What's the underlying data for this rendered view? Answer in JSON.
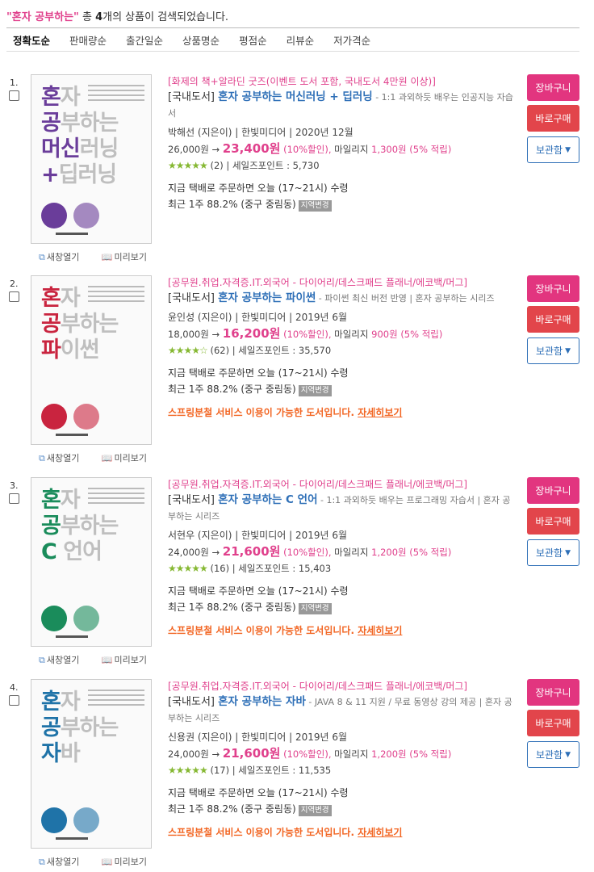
{
  "header": {
    "query": "\"혼자 공부하는\"",
    "prefix": " 총 ",
    "count": "4",
    "suffix": "개의 상품이 검색되었습니다."
  },
  "sort_options": [
    "정확도순",
    "판매량순",
    "출간일순",
    "상품명순",
    "평점순",
    "리뷰순",
    "저가격순"
  ],
  "actions": {
    "cart": "장바구니",
    "buy": "바로구매",
    "keep": "보관함"
  },
  "cover_links": {
    "new_window": "새창열기",
    "preview": "미리보기"
  },
  "colors": {
    "pink": "#e0408c",
    "title_blue": "#2e6fb7",
    "orange": "#f26522",
    "star_green": "#86b833"
  },
  "items": [
    {
      "num": "1.",
      "cover": {
        "l1": [
          "혼",
          "자"
        ],
        "l2": [
          "공",
          "부하는"
        ],
        "l3": [
          "머신",
          "러닝"
        ],
        "l4": [
          "+",
          "딥러닝"
        ],
        "color": "#6a3d9a"
      },
      "event": "[화제의 책+알라딘 굿즈(이벤트 도서 포함, 국내도서 4만원 이상)]",
      "category": "[국내도서]",
      "title": "혼자 공부하는 머신러닝 + 딥러닝",
      "subtitle": " - 1:1 과외하듯 배우는 인공지능 자습서",
      "meta": "박해선 (지은이) | 한빛미디어 | 2020년 12월",
      "list_price": "26,000원 →",
      "sale_price": "23,400원",
      "discount": "(10%할인),",
      "mileage_label": " 마일리지",
      "mileage": "1,300원",
      "rate": "(5% 적립)",
      "stars": "★★★★★",
      "reviews": "(2)",
      "salespoint": "세일즈포인트 : 5,730",
      "delivery1": "지금 택배로 주문하면 오늘 (17~21시) 수령",
      "delivery2": "최근 1주 88.2% (중구 중림동)",
      "region": "지역변경",
      "spring": "",
      "spring_more": ""
    },
    {
      "num": "2.",
      "cover": {
        "l1": [
          "혼",
          "자"
        ],
        "l2": [
          "공",
          "부하는"
        ],
        "l3": [
          "파",
          "이썬"
        ],
        "l4": [
          "",
          ""
        ],
        "color": "#c9243f"
      },
      "event": "[공무원.취업.자격증.IT.외국어 - 다이어리/데스크패드 플래너/에코백/머그]",
      "category": "[국내도서]",
      "title": "혼자 공부하는 파이썬",
      "subtitle": " - 파이썬 최신 버전 반영 | 혼자 공부하는 시리즈",
      "meta": "윤인성 (지은이) | 한빛미디어 | 2019년 6월",
      "list_price": "18,000원 →",
      "sale_price": "16,200원",
      "discount": "(10%할인),",
      "mileage_label": " 마일리지",
      "mileage": "900원",
      "rate": "(5% 적립)",
      "stars": "★★★★☆",
      "reviews": "(62)",
      "salespoint": "세일즈포인트 : 35,570",
      "delivery1": "지금 택배로 주문하면 오늘 (17~21시) 수령",
      "delivery2": "최근 1주 88.2% (중구 중림동)",
      "region": "지역변경",
      "spring": "스프링분철 서비스 이용이 가능한 도서입니다. ",
      "spring_more": "자세히보기"
    },
    {
      "num": "3.",
      "cover": {
        "l1": [
          "혼",
          "자"
        ],
        "l2": [
          "공",
          "부하는"
        ],
        "l3": [
          "C",
          " 언어"
        ],
        "l4": [
          "",
          ""
        ],
        "color": "#1a8c5b"
      },
      "event": "[공무원.취업.자격증.IT.외국어 - 다이어리/데스크패드 플래너/에코백/머그]",
      "category": "[국내도서]",
      "title": "혼자 공부하는 C 언어",
      "subtitle": " - 1:1 과외하듯 배우는 프로그래밍 자습서 | 혼자 공부하는 시리즈",
      "meta": "서현우 (지은이) | 한빛미디어 | 2019년 6월",
      "list_price": "24,000원 →",
      "sale_price": "21,600원",
      "discount": "(10%할인),",
      "mileage_label": " 마일리지",
      "mileage": "1,200원",
      "rate": "(5% 적립)",
      "stars": "★★★★★",
      "reviews": "(16)",
      "salespoint": "세일즈포인트 : 15,403",
      "delivery1": "지금 택배로 주문하면 오늘 (17~21시) 수령",
      "delivery2": "최근 1주 88.2% (중구 중림동)",
      "region": "지역변경",
      "spring": "스프링분철 서비스 이용이 가능한 도서입니다. ",
      "spring_more": "자세히보기"
    },
    {
      "num": "4.",
      "cover": {
        "l1": [
          "혼",
          "자"
        ],
        "l2": [
          "공",
          "부하는"
        ],
        "l3": [
          "자",
          "바"
        ],
        "l4": [
          "",
          ""
        ],
        "color": "#1f73a8"
      },
      "event": "[공무원.취업.자격증.IT.외국어 - 다이어리/데스크패드 플래너/에코백/머그]",
      "category": "[국내도서]",
      "title": "혼자 공부하는 자바",
      "subtitle": " - JAVA 8 & 11 지원 / 무료 동영상 강의 제공 | 혼자 공부하는 시리즈",
      "meta": "신용권 (지은이) | 한빛미디어 | 2019년 6월",
      "list_price": "24,000원 →",
      "sale_price": "21,600원",
      "discount": "(10%할인),",
      "mileage_label": " 마일리지",
      "mileage": "1,200원",
      "rate": "(5% 적립)",
      "stars": "★★★★★",
      "reviews": "(17)",
      "salespoint": "세일즈포인트 : 11,535",
      "delivery1": "지금 택배로 주문하면 오늘 (17~21시) 수령",
      "delivery2": "최근 1주 88.2% (중구 중림동)",
      "region": "지역변경",
      "spring": "스프링분철 서비스 이용이 가능한 도서입니다. ",
      "spring_more": "자세히보기"
    }
  ]
}
